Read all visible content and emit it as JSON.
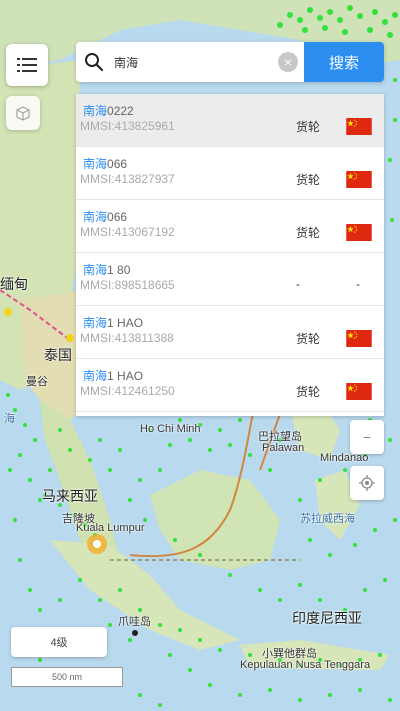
{
  "search": {
    "query": "南海",
    "button_label": "搜索"
  },
  "results": [
    {
      "highlight": "南海",
      "suffix": "0222",
      "mmsi": "MMSI:413825961",
      "type": "货轮",
      "flag": "cn",
      "selected": true
    },
    {
      "highlight": "南海",
      "suffix": "066",
      "mmsi": "MMSI:413827937",
      "type": "货轮",
      "flag": "cn"
    },
    {
      "highlight": "南海",
      "suffix": "066",
      "mmsi": "MMSI:413067192",
      "type": "货轮",
      "flag": "cn"
    },
    {
      "highlight": "南海",
      "suffix": "1 80",
      "mmsi": "MMSI:898518665",
      "type": "-",
      "flag": "-"
    },
    {
      "highlight": "南海",
      "suffix": "1 HAO",
      "mmsi": "MMSI:413811388",
      "type": "货轮",
      "flag": "cn"
    },
    {
      "highlight": "南海",
      "suffix": "1 HAO",
      "mmsi": "MMSI:412461250",
      "type": "货轮",
      "flag": "cn"
    }
  ],
  "map": {
    "labels": {
      "myanmar": "缅甸",
      "thailand": "泰国",
      "bangkok": "曼谷",
      "ho_chi_minh": "Ho Chi Minh",
      "palawan_cn": "巴拉望岛",
      "palawan": "Palawan",
      "mindanao": "Mindanao",
      "malaysia": "马来西亚",
      "kuala_lumpur_cn": "吉隆坡",
      "kuala_lumpur": "Kuala Lumpur",
      "indonesia": "印度尼西亚",
      "kepulauan": "Kepulauan Nusa Tenggara",
      "lesser_sunda": "小巽他群岛",
      "celebes_sea": "苏拉威西海",
      "java_cn": "爪哇岛",
      "sea_left": "海"
    },
    "zoom_level": "4级",
    "scale_label": "500 nm"
  },
  "colors": {
    "accent": "#2b8ef0",
    "ship_dots": "#34e03a",
    "flag_red": "#de2910",
    "flag_yellow": "#ffde00"
  }
}
